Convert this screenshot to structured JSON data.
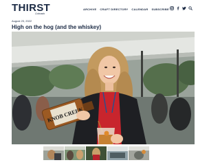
{
  "site": {
    "logo_text": "THIRST",
    "logo_sub": "Colorado"
  },
  "nav": {
    "items": [
      {
        "label": "ARCHIVE"
      },
      {
        "label": "CRAFT DIRECTORY"
      },
      {
        "label": "CALENDAR"
      },
      {
        "label": "SUBSCRIBE"
      }
    ]
  },
  "social": {
    "icons": [
      "instagram-icon",
      "facebook-icon",
      "twitter-icon",
      "search-icon"
    ]
  },
  "article": {
    "date": "August 23, 2022",
    "title": "High on the hog (and the whiskey)"
  },
  "hero": {
    "bottle_brand": "KNOB CREEK"
  },
  "gallery": {
    "thumbnail_count": 5
  },
  "colors": {
    "brand_navy": "#1b2a44"
  }
}
